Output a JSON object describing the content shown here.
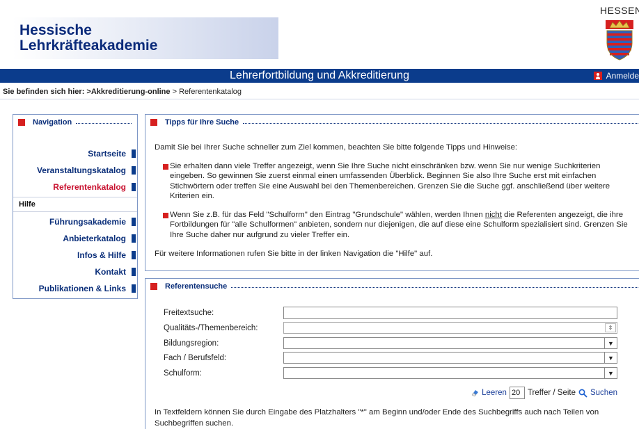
{
  "header": {
    "logo_line1": "Hessische",
    "logo_line2": "Lehrkräfteakademie",
    "state_name": "HESSEN",
    "title": "Lehrerfortbildung und Akkreditierung",
    "login_label": "Anmelde"
  },
  "breadcrumb": {
    "label": "Sie befinden sich hier:",
    "separator1": " >",
    "link": "Akkreditierung-online",
    "separator2": " > ",
    "current": "Referentenkatalog"
  },
  "nav": {
    "title": "Navigation",
    "items": [
      {
        "label": "Startseite"
      },
      {
        "label": "Veranstaltungskatalog"
      },
      {
        "label": "Referentenkatalog"
      },
      {
        "label": "Hilfe"
      },
      {
        "label": "Führungsakademie"
      },
      {
        "label": "Anbieterkatalog"
      },
      {
        "label": "Infos & Hilfe"
      },
      {
        "label": "Kontakt"
      },
      {
        "label": "Publikationen & Links"
      }
    ],
    "active_color": "#c8102e"
  },
  "tips": {
    "title": "Tipps für Ihre Suche",
    "intro": "Damit Sie bei Ihrer Suche schneller zum Ziel kommen, beachten Sie bitte folgende Tipps und Hinweise:",
    "tip1": "Sie erhalten dann viele Treffer angezeigt, wenn Sie Ihre Suche nicht einschränken bzw. wenn Sie nur wenige Suchkriterien eingeben. So gewinnen Sie zuerst einmal einen umfassenden Überblick. Beginnen Sie also Ihre Suche erst mit einfachen Stichwörtern oder treffen Sie eine Auswahl bei den Themenbereichen. Grenzen Sie die Suche ggf. anschließend über weitere Kriterien ein.",
    "tip2_pre": "Wenn Sie z.B. für das Feld \"Schulform\" den Eintrag \"Grundschule\" wählen, werden Ihnen ",
    "tip2_emph": "nicht",
    "tip2_post": " die Referenten angezeigt, die ihre Fortbildungen für \"alle Schulformen\" anbieten, sondern nur diejenigen, die auf diese eine Schulform spezialisiert sind. Grenzen Sie Ihre Suche daher nur aufgrund zu vieler Treffer ein.",
    "footer": "Für weitere Informationen rufen Sie bitte in der linken Navigation die \"Hilfe\" auf."
  },
  "search": {
    "title": "Referentensuche",
    "fields": {
      "freitext": {
        "label": "Freitextsuche:",
        "value": ""
      },
      "themen": {
        "label": "Qualitäts-/Themenbereich:",
        "value": ""
      },
      "region": {
        "label": "Bildungsregion:",
        "value": ""
      },
      "fach": {
        "label": "Fach / Berufsfeld:",
        "value": ""
      },
      "schulform": {
        "label": "Schulform:",
        "value": ""
      }
    },
    "clear_label": "Leeren",
    "hits_value": "20",
    "hits_suffix": "Treffer / Seite",
    "search_label": "Suchen",
    "hint": "In Textfeldern können Sie durch Eingabe des Platzhalters \"*\" am Beginn und/oder Ende des Suchbegriffs auch nach Teilen von Suchbegriffen suchen."
  },
  "colors": {
    "brand_blue": "#0b3c8c",
    "accent_red": "#d6201f",
    "link_blue": "#0b2f7a"
  }
}
